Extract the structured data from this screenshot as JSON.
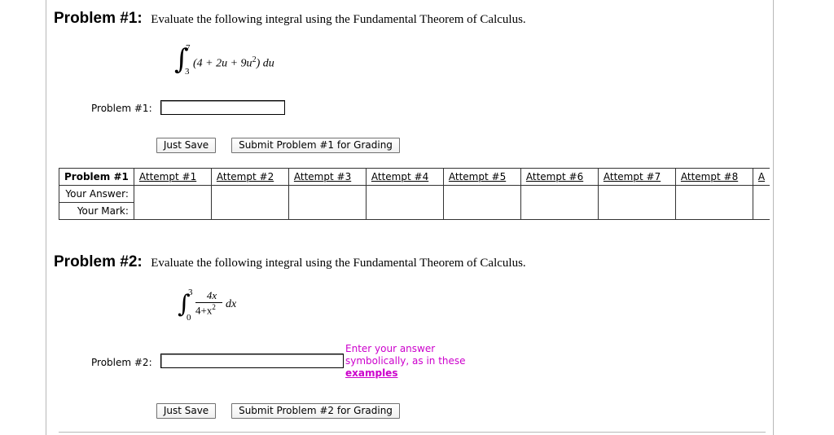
{
  "problem1": {
    "heading_num": "Problem #1:",
    "heading_text": "Evaluate the following integral using the Fundamental Theorem of Calculus.",
    "integral": {
      "upper": "7",
      "lower": "3",
      "integrand": "(4 + 2u + 9u",
      "exp": "2",
      "close": ")",
      "diff": "du"
    },
    "answer_label": "Problem #1:",
    "answer_value": "",
    "just_save": "Just Save",
    "submit": "Submit Problem #1 for Grading"
  },
  "attempts_table": {
    "header": "Problem #1",
    "attempts": [
      "Attempt #1",
      "Attempt #2",
      "Attempt #3",
      "Attempt #4",
      "Attempt #5",
      "Attempt #6",
      "Attempt #7",
      "Attempt #8",
      "A"
    ],
    "row_answer": "Your Answer:",
    "row_mark": "Your Mark:"
  },
  "problem2": {
    "heading_num": "Problem #2:",
    "heading_text": "Evaluate the following integral using the Fundamental Theorem of Calculus.",
    "integral": {
      "upper": "3",
      "lower": "0",
      "numerator": "4x",
      "denominator": "4+x",
      "den_exp": "2",
      "diff": "dx"
    },
    "answer_label": "Problem #2:",
    "answer_value": "",
    "hint_line1": "Enter your answer",
    "hint_line2": "symbolically, as in these",
    "hint_link": "examples",
    "just_save": "Just Save",
    "submit": "Submit Problem #2 for Grading"
  },
  "colors": {
    "hint": "#cc00cc",
    "border": "#333333"
  }
}
